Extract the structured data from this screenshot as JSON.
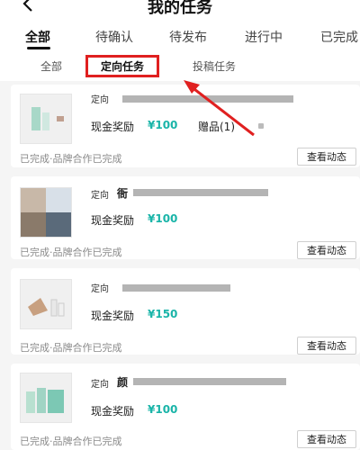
{
  "header": {
    "title": "我的任务"
  },
  "status_tabs": [
    "全部",
    "待确认",
    "待发布",
    "进行中",
    "已完成"
  ],
  "sub_tabs": [
    "全部",
    "定向任务",
    "投稿任务"
  ],
  "tasks": [
    {
      "tag": "定向",
      "reward_label": "现金奖励",
      "reward_amount": "¥100",
      "gift": "赠品(1)",
      "footer": "已完成·品牌合作已完成",
      "button": "查看动态"
    },
    {
      "tag": "定向",
      "name_char": "衙",
      "reward_label": "现金奖励",
      "reward_amount": "¥100",
      "footer": "已完成·品牌合作已完成",
      "button": "查看动态"
    },
    {
      "tag": "定向",
      "reward_label": "现金奖励",
      "reward_amount": "¥150",
      "footer": "已完成·品牌合作已完成",
      "button": "查看动态"
    },
    {
      "tag": "定向",
      "name_char": "颜",
      "reward_label": "现金奖励",
      "reward_amount": "¥100",
      "footer": "已完成·品牌合作已完成",
      "button": "查看动态"
    }
  ],
  "colors": {
    "accent": "#19b4a8",
    "highlight": "#e02020"
  },
  "icons": [
    "back-arrow-icon"
  ]
}
